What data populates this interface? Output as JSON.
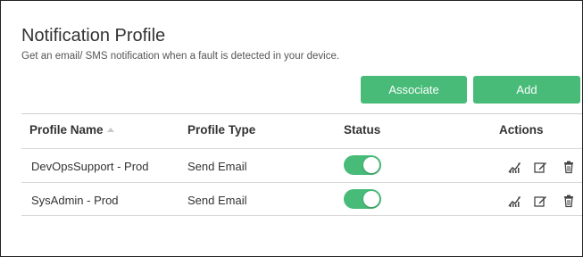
{
  "header": {
    "title": "Notification Profile",
    "subtitle": "Get an email/ SMS notification when a fault is detected in your device."
  },
  "toolbar": {
    "associate_label": "Associate",
    "add_label": "Add"
  },
  "colors": {
    "accent": "#48bb78",
    "text": "#333333"
  },
  "table": {
    "columns": [
      "Profile Name",
      "Profile Type",
      "Status",
      "Actions"
    ],
    "sort_column": "Profile Name",
    "rows": [
      {
        "name": "DevOpsSupport - Prod",
        "type": "Send Email",
        "status": "on"
      },
      {
        "name": "SysAdmin - Prod",
        "type": "Send Email",
        "status": "on"
      }
    ],
    "row_actions": [
      "graph-icon",
      "edit-icon",
      "delete-icon"
    ]
  }
}
